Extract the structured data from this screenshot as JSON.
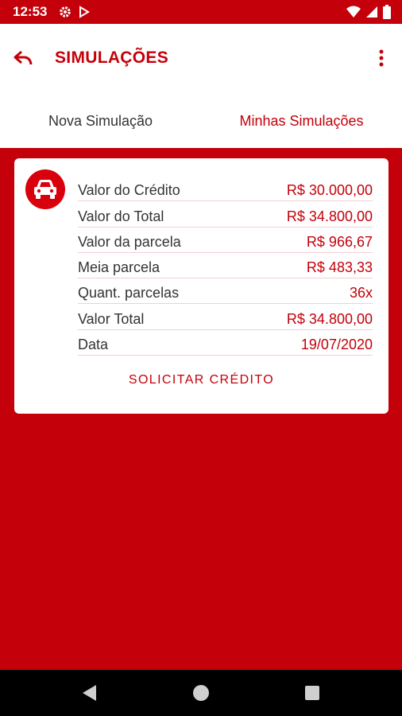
{
  "status_bar": {
    "time": "12:53",
    "icons": [
      "settings-icon",
      "play-store-icon",
      "wifi-icon",
      "signal-icon",
      "battery-icon"
    ]
  },
  "app_bar": {
    "title": "SIMULAÇÕES",
    "back_icon": "reply-arrow-icon",
    "menu_icon": "more-vert-icon"
  },
  "tabs": [
    {
      "label": "Nova Simulação",
      "selected": false
    },
    {
      "label": "Minhas Simulações",
      "selected": true
    }
  ],
  "simulation_card": {
    "icon": "car-icon",
    "rows": [
      {
        "label": "Valor do Crédito",
        "value": "R$ 30.000,00"
      },
      {
        "label": "Valor do Total",
        "value": "R$ 34.800,00"
      },
      {
        "label": "Valor da parcela",
        "value": "R$ 966,67"
      },
      {
        "label": "Meia parcela",
        "value": "R$ 483,33"
      },
      {
        "label": "Quant. parcelas",
        "value": "36x"
      },
      {
        "label": "Valor Total",
        "value": "R$ 34.800,00"
      },
      {
        "label": "Data",
        "value": "19/07/2020"
      }
    ],
    "action_label": "SOLICITAR CRÉDITO"
  },
  "colors": {
    "brand_red": "#c4000a",
    "card_bg": "#ffffff",
    "text_dark": "#333333"
  }
}
